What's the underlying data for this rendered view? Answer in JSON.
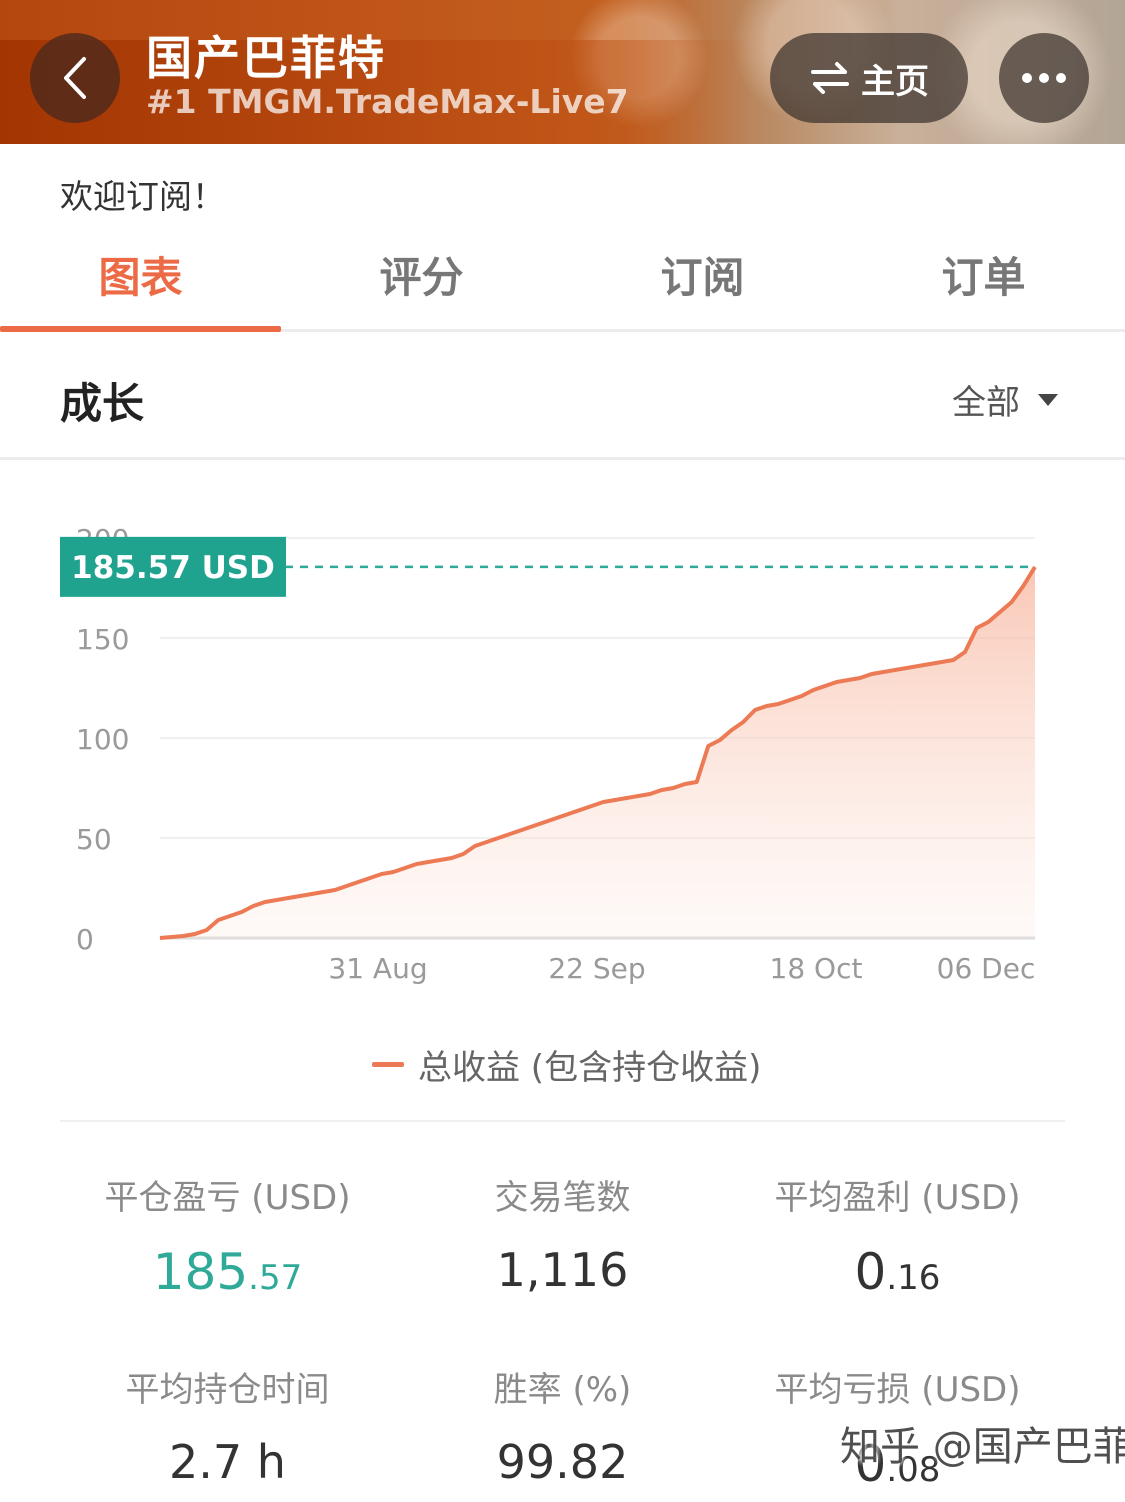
{
  "header": {
    "title": "国产巴菲特",
    "subtitle": "#1 TMGM.TradeMax-Live7",
    "home_label": "主页",
    "back_icon": "chevron-left-icon",
    "swap_icon": "swap-arrows-icon",
    "more_icon": "ellipsis-icon"
  },
  "welcome_text": "欢迎订阅！",
  "tabs": [
    {
      "label": "图表",
      "active": true
    },
    {
      "label": "评分",
      "active": false
    },
    {
      "label": "订阅",
      "active": false
    },
    {
      "label": "订单",
      "active": false
    }
  ],
  "section": {
    "title": "成长",
    "range_label": "全部"
  },
  "chart_data": {
    "type": "area",
    "current_value_label": "185.57 USD",
    "ylim": [
      0,
      200
    ],
    "y_ticks": [
      "0",
      "50",
      "100",
      "150",
      "200"
    ],
    "x_ticks": [
      "31 Aug",
      "22 Sep",
      "18 Oct",
      "06 Dec"
    ],
    "grid": true,
    "series": [
      {
        "name": "总收益 (包含持仓收益)",
        "color": "#ec7a55",
        "values": [
          0,
          0.5,
          1,
          2,
          4,
          9,
          11,
          13,
          16,
          18,
          19,
          20,
          21,
          22,
          23,
          24,
          26,
          28,
          30,
          32,
          33,
          35,
          37,
          38,
          39,
          40,
          42,
          46,
          48,
          50,
          52,
          54,
          56,
          58,
          60,
          62,
          64,
          66,
          68,
          69,
          70,
          71,
          72,
          74,
          75,
          77,
          78,
          96,
          99,
          104,
          108,
          114,
          116,
          117,
          119,
          121,
          124,
          126,
          128,
          129,
          130,
          132,
          133,
          134,
          135,
          136,
          137,
          138,
          139,
          143,
          155,
          158,
          163,
          168,
          176,
          185.57
        ]
      }
    ],
    "legend_position": "bottom"
  },
  "stats": [
    {
      "label": "平仓盈亏 (USD)",
      "int": "185",
      "dec": ".57",
      "highlight": true
    },
    {
      "label": "交易笔数",
      "int": "1,116",
      "dec": "",
      "highlight": false
    },
    {
      "label": "平均盈利 (USD)",
      "int": "0",
      "dec": ".16",
      "highlight": false
    },
    {
      "label": "平均持仓时间",
      "int": "2.7 h",
      "dec": "",
      "highlight": false
    },
    {
      "label": "胜率 (%)",
      "int": "99.82",
      "dec": "",
      "highlight": false
    },
    {
      "label": "平均亏损 (USD)",
      "int": "0",
      "dec": ".08",
      "highlight": false
    }
  ],
  "watermark": "知乎 @国产巴菲特",
  "colors": {
    "accent": "#ec6b46",
    "chart_line": "#ec7a55",
    "highlight_green": "#2fa998",
    "marker_bg": "#1fa38f"
  }
}
